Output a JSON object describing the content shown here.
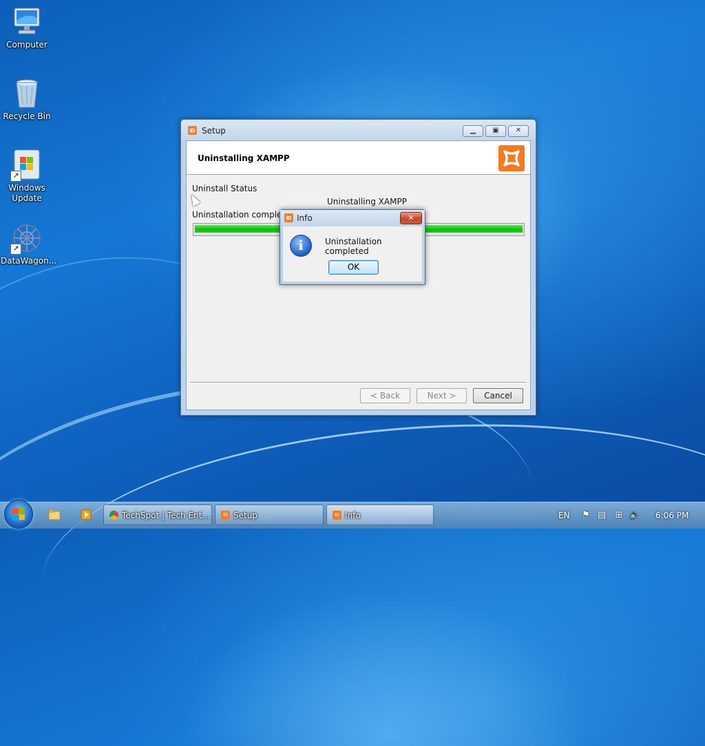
{
  "desktop": {
    "icons": [
      {
        "label": "Computer",
        "icon": "computer-icon"
      },
      {
        "label": "Recycle Bin",
        "icon": "recycle-bin-icon"
      },
      {
        "label": "Windows\nUpdate",
        "icon": "windows-update-icon"
      },
      {
        "label": "DataWagon...",
        "icon": "datawagon-icon"
      }
    ]
  },
  "setup_window": {
    "title": "Setup",
    "header_title": "Uninstalling XAMPP",
    "status_label": "Uninstall Status",
    "status_center": "Uninstalling XAMPP",
    "status_detail": "Uninstallation completed",
    "progress": 1.0,
    "buttons": {
      "back": "< Back",
      "next": "Next >",
      "cancel": "Cancel"
    }
  },
  "info_dialog": {
    "title": "Info",
    "message": "Uninstallation completed",
    "ok": "OK",
    "close_glyph": "✕"
  },
  "taskbar": {
    "tasks": [
      {
        "label": "TechSpot | Tech Ent...",
        "icon": "chrome-icon"
      },
      {
        "label": "Setup",
        "icon": "xampp-icon"
      },
      {
        "label": "Info",
        "icon": "xampp-icon"
      }
    ],
    "language": "EN",
    "clock": "6:06 PM"
  },
  "colors": {
    "xampp_orange": "#f57921",
    "progress_green": "#06c206",
    "desktop_blue": "#1578d4"
  }
}
